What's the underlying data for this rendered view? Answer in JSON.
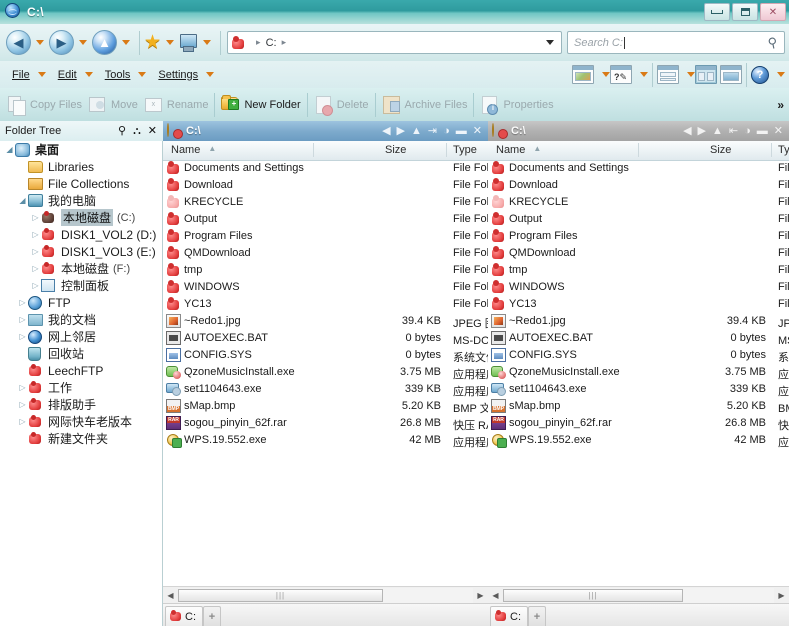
{
  "window": {
    "title": "C:\\",
    "icon": "globe-icon",
    "buttons": {
      "minimize": "minimize",
      "maximize": "maximize",
      "close": "close"
    }
  },
  "navbar": {
    "back": "back-orb",
    "forward": "forward-orb",
    "up": "up-orb",
    "favorites": "star-icon",
    "computer": "computer-icon",
    "address": {
      "icon": "red-drive-icon",
      "crumbs": [
        "C:"
      ],
      "dropdown": "chevron-down-icon"
    },
    "search": {
      "placeholder": "Search C:",
      "value": "",
      "icon": "search-icon"
    }
  },
  "menubar": {
    "items": [
      {
        "label": "File",
        "accel": "F"
      },
      {
        "label": "Edit",
        "accel": "E"
      },
      {
        "label": "Tools",
        "accel": "T"
      },
      {
        "label": "Settings",
        "accel": "S"
      }
    ],
    "view_buttons": [
      {
        "name": "thumbnails-view-button",
        "icon": "thumbnails-icon"
      },
      {
        "name": "edit-view-button",
        "icon": "edit-pencil-icon"
      },
      {
        "name": "horizontal-split-button",
        "icon": "split-horizontal-icon"
      },
      {
        "name": "vertical-split-button",
        "icon": "split-vertical-icon",
        "selected": true
      },
      {
        "name": "single-pane-button",
        "icon": "single-pane-icon"
      },
      {
        "name": "help-button",
        "icon": "help-icon"
      }
    ]
  },
  "toolbar": {
    "items": [
      {
        "label": "Copy Files",
        "icon": "copy-icon",
        "enabled": false
      },
      {
        "label": "Move",
        "icon": "move-icon",
        "enabled": false
      },
      {
        "label": "Rename",
        "icon": "rename-icon",
        "enabled": false
      },
      {
        "label": "New Folder",
        "icon": "new-folder-icon",
        "enabled": true
      },
      {
        "label": "Delete",
        "icon": "delete-icon",
        "enabled": false
      },
      {
        "label": "Archive Files",
        "icon": "archive-icon",
        "enabled": false
      },
      {
        "label": "Properties",
        "icon": "properties-icon",
        "enabled": false
      }
    ],
    "overflow": "»"
  },
  "tree": {
    "title": "Folder Tree",
    "header_icons": [
      "search-icon",
      "unpin-icon",
      "close-icon"
    ],
    "nodes": [
      {
        "label": "桌面",
        "icon": "desktop-icon",
        "indent": 0,
        "expander": "open",
        "bold": true
      },
      {
        "label": "Libraries",
        "icon": "library-folder-icon",
        "indent": 1,
        "expander": ""
      },
      {
        "label": "File Collections",
        "icon": "collections-folder-icon",
        "indent": 1,
        "expander": ""
      },
      {
        "label": "我的电脑",
        "icon": "my-computer-icon",
        "indent": 1,
        "expander": "open"
      },
      {
        "label": "本地磁盘",
        "sub": "(C:)",
        "icon": "drive-dark-icon",
        "indent": 2,
        "expander": "closed",
        "selected": true
      },
      {
        "label": "DISK1_VOL2 (D:)",
        "icon": "drive-red-icon",
        "indent": 2,
        "expander": "closed"
      },
      {
        "label": "DISK1_VOL3 (E:)",
        "icon": "drive-red-icon",
        "indent": 2,
        "expander": "closed"
      },
      {
        "label": "本地磁盘",
        "sub": "(F:)",
        "icon": "drive-red-icon",
        "indent": 2,
        "expander": "closed"
      },
      {
        "label": "控制面板",
        "icon": "control-panel-icon",
        "indent": 2,
        "expander": "closed"
      },
      {
        "label": "FTP",
        "icon": "ftp-globe-icon",
        "indent": 1,
        "expander": "closed"
      },
      {
        "label": "我的文档",
        "icon": "my-documents-icon",
        "indent": 1,
        "expander": "closed"
      },
      {
        "label": "网上邻居",
        "icon": "network-icon",
        "indent": 1,
        "expander": "closed"
      },
      {
        "label": "回收站",
        "icon": "recycle-bin-icon",
        "indent": 1,
        "expander": ""
      },
      {
        "label": "LeechFTP",
        "icon": "drive-red-icon",
        "indent": 1,
        "expander": ""
      },
      {
        "label": "工作",
        "icon": "drive-red-icon",
        "indent": 1,
        "expander": "closed"
      },
      {
        "label": "排版助手",
        "icon": "drive-red-icon",
        "indent": 1,
        "expander": "closed"
      },
      {
        "label": "网际快车老版本",
        "icon": "drive-red-icon",
        "indent": 1,
        "expander": "closed"
      },
      {
        "label": "新建文件夹",
        "icon": "drive-red-icon",
        "indent": 1,
        "expander": ""
      }
    ]
  },
  "panels": [
    {
      "name": "left",
      "title": "C:\\",
      "active": true,
      "titlebar_buttons": [
        "back-icon",
        "forward-icon",
        "up-icon",
        "swap-right-icon",
        "swap-icon",
        "minimize-icon",
        "close-icon"
      ],
      "columns": [
        "Name",
        "Size",
        "Type"
      ],
      "sort": {
        "column": "Name",
        "direction": "asc"
      },
      "tab": {
        "label": "C:",
        "icon": "red-drive-icon",
        "add": "+"
      },
      "rows": [
        {
          "name": "Documents and Settings",
          "size": "",
          "type": "File Folder",
          "icon": "folder-icon"
        },
        {
          "name": "Download",
          "size": "",
          "type": "File Folder",
          "icon": "folder-icon"
        },
        {
          "name": "KRECYCLE",
          "size": "",
          "type": "File Folder",
          "icon": "folder-pale-icon"
        },
        {
          "name": "Output",
          "size": "",
          "type": "File Folder",
          "icon": "folder-icon"
        },
        {
          "name": "Program Files",
          "size": "",
          "type": "File Folder",
          "icon": "folder-icon"
        },
        {
          "name": "QMDownload",
          "size": "",
          "type": "File Folder",
          "icon": "folder-icon"
        },
        {
          "name": "tmp",
          "size": "",
          "type": "File Folder",
          "icon": "folder-icon"
        },
        {
          "name": "WINDOWS",
          "size": "",
          "type": "File Folder",
          "icon": "folder-icon"
        },
        {
          "name": "YC13",
          "size": "",
          "type": "File Folder",
          "icon": "folder-icon"
        },
        {
          "name": "~Redo1.jpg",
          "size": "39.4 KB",
          "type": "JPEG 图像",
          "icon": "image-file-icon"
        },
        {
          "name": "AUTOEXEC.BAT",
          "size": "0 bytes",
          "type": "MS-DOS 批处理文件",
          "icon": "batch-file-icon"
        },
        {
          "name": "CONFIG.SYS",
          "size": "0 bytes",
          "type": "系统文件",
          "icon": "system-file-icon"
        },
        {
          "name": "QzoneMusicInstall.exe",
          "size": "3.75 MB",
          "type": "应用程序",
          "icon": "exe-green-icon"
        },
        {
          "name": "set1104643.exe",
          "size": "339 KB",
          "type": "应用程序",
          "icon": "exe-blue-icon"
        },
        {
          "name": "sMap.bmp",
          "size": "5.20 KB",
          "type": "BMP 文件",
          "icon": "bmp-file-icon"
        },
        {
          "name": "sogou_pinyin_62f.rar",
          "size": "26.8 MB",
          "type": "快压 RAR 压缩文件",
          "icon": "rar-file-icon"
        },
        {
          "name": "WPS.19.552.exe",
          "size": "42 MB",
          "type": "应用程序",
          "icon": "wps-exe-icon"
        }
      ]
    },
    {
      "name": "right",
      "title": "C:\\",
      "active": false,
      "titlebar_buttons": [
        "back-icon",
        "forward-icon",
        "up-icon",
        "swap-left-icon",
        "swap-icon",
        "minimize-icon",
        "close-icon"
      ],
      "columns": [
        "Name",
        "Size",
        "Type"
      ],
      "sort": {
        "column": "Name",
        "direction": "asc"
      },
      "tab": {
        "label": "C:",
        "icon": "red-drive-icon",
        "add": "+"
      },
      "rows": [
        {
          "name": "Documents and Settings",
          "size": "",
          "type": "File Folder",
          "icon": "folder-icon"
        },
        {
          "name": "Download",
          "size": "",
          "type": "File Folder",
          "icon": "folder-icon"
        },
        {
          "name": "KRECYCLE",
          "size": "",
          "type": "File Folder",
          "icon": "folder-pale-icon"
        },
        {
          "name": "Output",
          "size": "",
          "type": "File Folder",
          "icon": "folder-icon"
        },
        {
          "name": "Program Files",
          "size": "",
          "type": "File Folder",
          "icon": "folder-icon"
        },
        {
          "name": "QMDownload",
          "size": "",
          "type": "File Folder",
          "icon": "folder-icon"
        },
        {
          "name": "tmp",
          "size": "",
          "type": "File Folder",
          "icon": "folder-icon"
        },
        {
          "name": "WINDOWS",
          "size": "",
          "type": "File Folder",
          "icon": "folder-icon"
        },
        {
          "name": "YC13",
          "size": "",
          "type": "File Folder",
          "icon": "folder-icon"
        },
        {
          "name": "~Redo1.jpg",
          "size": "39.4 KB",
          "type": "JPEG 图像",
          "icon": "image-file-icon"
        },
        {
          "name": "AUTOEXEC.BAT",
          "size": "0 bytes",
          "type": "MS-DOS 批处理文",
          "icon": "batch-file-icon"
        },
        {
          "name": "CONFIG.SYS",
          "size": "0 bytes",
          "type": "系统文件",
          "icon": "system-file-icon"
        },
        {
          "name": "QzoneMusicInstall.exe",
          "size": "3.75 MB",
          "type": "应用程序",
          "icon": "exe-green-icon"
        },
        {
          "name": "set1104643.exe",
          "size": "339 KB",
          "type": "应用程序",
          "icon": "exe-blue-icon"
        },
        {
          "name": "sMap.bmp",
          "size": "5.20 KB",
          "type": "BMP 文件",
          "icon": "bmp-file-icon"
        },
        {
          "name": "sogou_pinyin_62f.rar",
          "size": "26.8 MB",
          "type": "快压 RAR 压缩文件",
          "icon": "rar-file-icon"
        },
        {
          "name": "WPS.19.552.exe",
          "size": "42 MB",
          "type": "应用程序",
          "icon": "wps-exe-icon"
        }
      ]
    }
  ],
  "colors": {
    "title_accent": "#2f9b9e",
    "panel_active": "#7eabcd",
    "panel_inactive": "#b1b1b1",
    "toolbar_bg": "#cce7e8",
    "selection": "#b6c6cc"
  }
}
